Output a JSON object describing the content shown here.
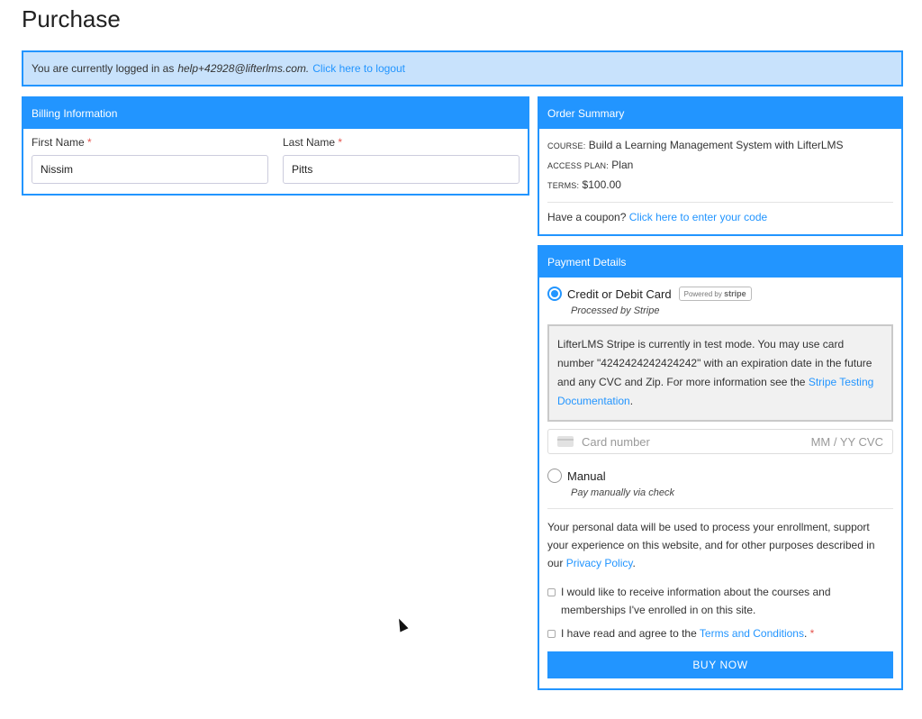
{
  "page": {
    "title": "Purchase"
  },
  "notice": {
    "prefix": "You are currently logged in as",
    "email": "help+42928@lifterlms.com.",
    "logout_link": "Click here to logout"
  },
  "billing": {
    "heading": "Billing Information",
    "first_name_label": "First Name",
    "first_name_value": "Nissim",
    "last_name_label": "Last Name",
    "last_name_value": "Pitts",
    "required_mark": "*"
  },
  "order": {
    "heading": "Order Summary",
    "course_key": "Course:",
    "course_value": "Build a Learning Management System with LifterLMS",
    "plan_key": "Access Plan:",
    "plan_value": "Plan",
    "terms_key": "Terms:",
    "terms_value": "$100.00",
    "coupon_prefix": "Have a coupon?",
    "coupon_link": "Click here to enter your code"
  },
  "payment": {
    "heading": "Payment Details",
    "gateway_card": {
      "title": "Credit or Debit Card",
      "badge_prefix": "Powered by",
      "badge_brand": "stripe",
      "description": "Processed by Stripe",
      "selected": true
    },
    "test_notice": {
      "text": "LifterLMS Stripe is currently in test mode. You may use card number \"4242424242424242\" with an expiration date in the future and any CVC and Zip. For more information see the",
      "link": "Stripe Testing Documentation",
      "suffix": "."
    },
    "card_input": {
      "placeholder": "Card number",
      "right_placeholder": "MM / YY  CVC"
    },
    "gateway_manual": {
      "title": "Manual",
      "description": "Pay manually via check",
      "selected": false
    },
    "privacy": {
      "text": "Your personal data will be used to process your enrollment, support your experience on this website, and for other purposes described in our",
      "link": "Privacy Policy",
      "suffix": "."
    },
    "marketing_checkbox": "I would like to receive information about the courses and memberships I've enrolled in on this site.",
    "terms_checkbox_prefix": "I have read and agree to the",
    "terms_link": "Terms and Conditions",
    "terms_suffix": ".",
    "required_mark": "*",
    "buy_button": "BUY NOW"
  },
  "colors": {
    "accent": "#2295ff",
    "notice_bg": "#c8e2fc",
    "required": "#e5554e"
  }
}
